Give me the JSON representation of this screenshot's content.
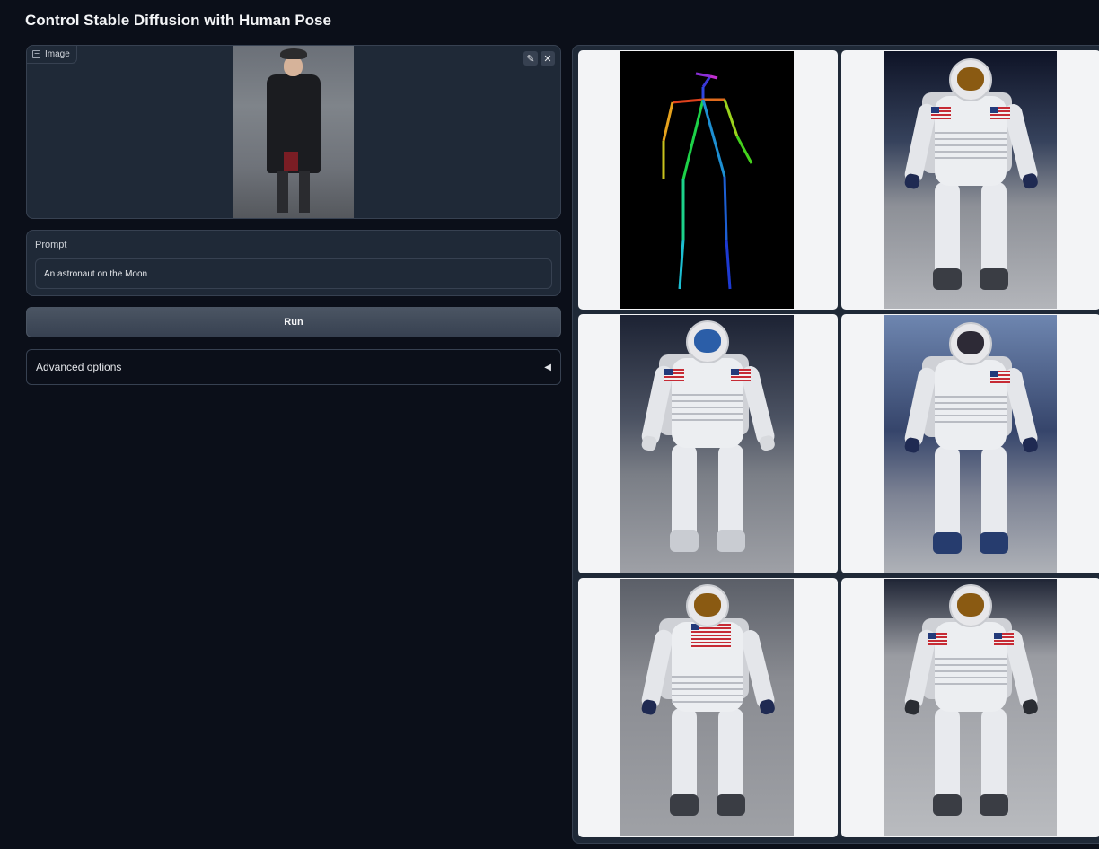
{
  "page": {
    "title": "Control Stable Diffusion with Human Pose"
  },
  "image_input": {
    "label": "Image",
    "edit_icon": "pencil-icon",
    "clear_icon": "close-icon"
  },
  "prompt": {
    "label": "Prompt",
    "value": "An astronaut on the Moon"
  },
  "run_button": {
    "label": "Run"
  },
  "advanced_options": {
    "label": "Advanced options",
    "caret": "◀"
  },
  "gallery": {
    "items": [
      {
        "kind": "pose skeleton",
        "caption": ""
      },
      {
        "kind": "astronaut",
        "caption": ""
      },
      {
        "kind": "astronaut",
        "caption": ""
      },
      {
        "kind": "astronaut",
        "caption": ""
      },
      {
        "kind": "astronaut",
        "caption": ""
      },
      {
        "kind": "astronaut",
        "caption": ""
      }
    ]
  }
}
